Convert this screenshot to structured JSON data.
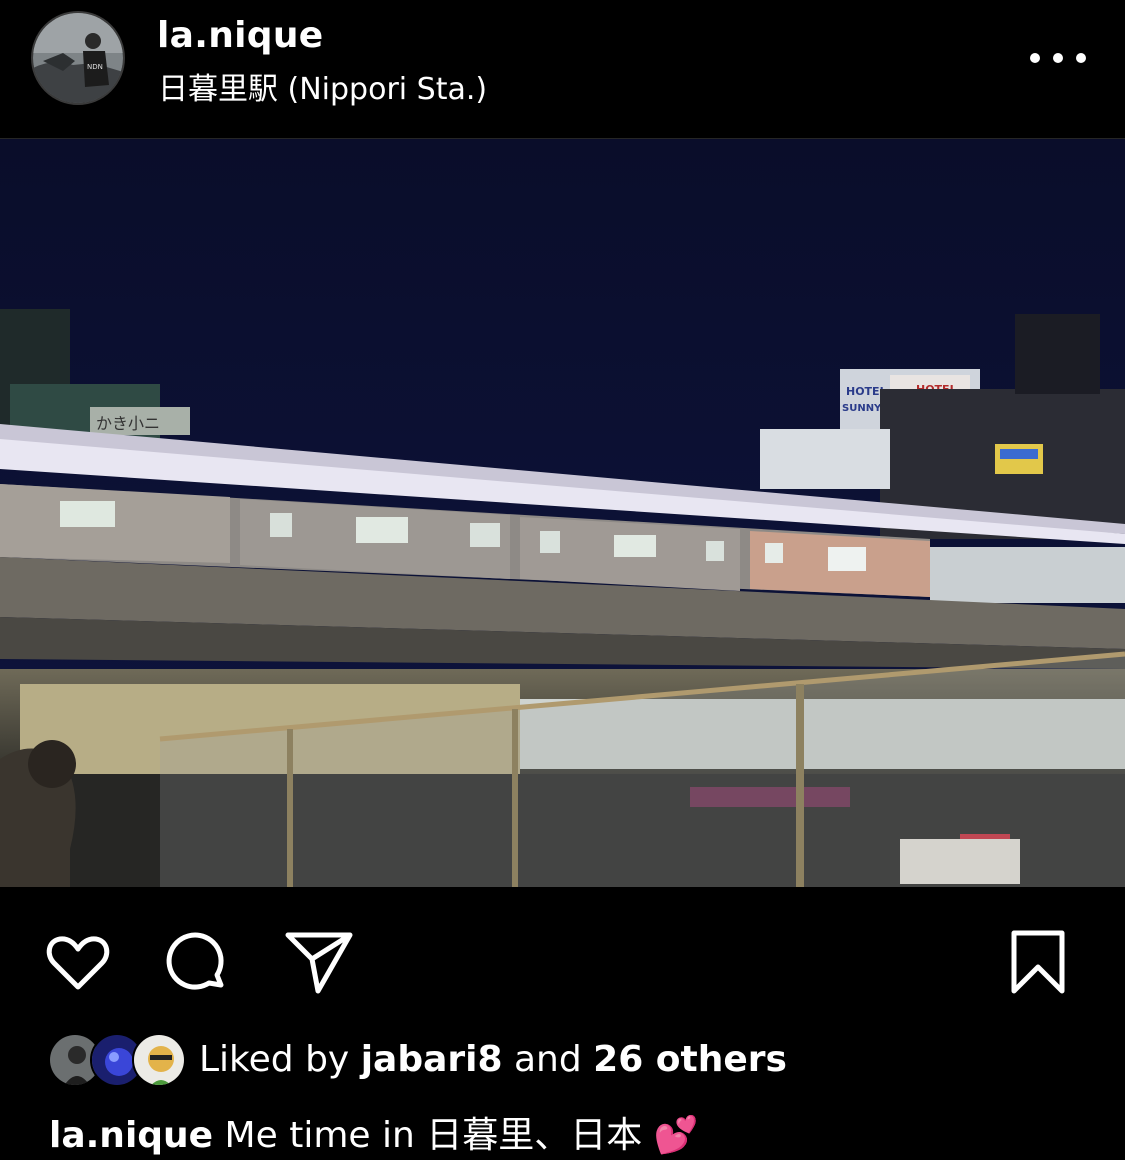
{
  "post": {
    "username": "la.nique",
    "location": "日暮里駅 (Nippori Sta.)",
    "more_icon": "more-horizontal-icon"
  },
  "actions": {
    "like_icon": "heart-icon",
    "comment_icon": "comment-icon",
    "share_icon": "send-icon",
    "save_icon": "bookmark-icon"
  },
  "likes": {
    "prefix": "Liked by",
    "first_user": "jabari8",
    "middle": "and",
    "others": "26 others"
  },
  "caption": {
    "username": "la.nique",
    "text": "Me time in 日暮里、日本",
    "emoji": "💕"
  },
  "photo": {
    "sign_1": "HOTEL",
    "sign_2": "SUNNY",
    "sign_3": "HOTEL",
    "sign_4": "SU",
    "sign_5": "かき小ニ"
  },
  "colors": {
    "background": "#000000",
    "text": "#ffffff",
    "divider": "#262626"
  }
}
